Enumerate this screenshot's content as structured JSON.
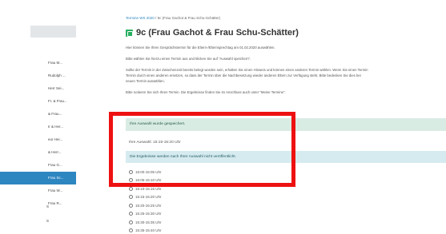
{
  "sidebar": {
    "items": [
      {
        "label": "Frau M..."
      },
      {
        "label": "Rudolph ..."
      },
      {
        "label": "Herr Sei..."
      },
      {
        "label": "Fr. & Frau..."
      },
      {
        "label": "& Frau..."
      },
      {
        "label": "Ir & Her..."
      },
      {
        "label": "eur Hei..."
      },
      {
        "label": "& Herr..."
      },
      {
        "label": "Frau G..."
      },
      {
        "label": "Frau Sc...",
        "active": true
      },
      {
        "label": "Frau W..."
      },
      {
        "label": "Frau R..."
      }
    ],
    "extra": [
      "S",
      "S"
    ]
  },
  "breadcrumb": {
    "home": "Termine WS 2020",
    "separator": "/",
    "current": "9c (Frau Gachot & Frau Schu-Schätter)"
  },
  "page": {
    "title": "9c (Frau Gachot & Frau Schu-Schätter)"
  },
  "paragraphs": [
    "Hier können Sie Ihren Gesprächstermin für die Eltern-/Elternsprechtag am 01.02.2020 auswählen.",
    "Bitte wählen Sie hierzu einen Termin aus und klicken Sie auf \"Auswahl speichern\".",
    "Sollte der Termin in der Zwischenzeit bereits belegt worden sein, erhalten Sie einen Hinweis und können einen anderen Termin wählen. Wenn Sie einen Termin",
    "Termin durch einen anderen ersetzen, so dass der Termin über die Nachbesetzung wieder anderen Eltern zur Verfügung steht. Bitte bedenken Sie dies bei",
    "neuen Termin auswählen.",
    "Bitte notieren Sie sich Ihren Termin. Die Ergebnisse finden Sie im Anschluss auch unter \"Meine Termine\"."
  ],
  "status": {
    "success": "Ihre Auswahl wurde gespeichert.",
    "choice": "Ihre Auswahl: 15:15-15:20 Uhr",
    "info": "Die Ergebnisse werden nach Ihrer Auswahl nicht veröffentlicht."
  },
  "slots": [
    {
      "label": "15:00-15:05 Uhr"
    },
    {
      "label": "15:05-15:10 Uhr"
    },
    {
      "label": "15:10-15:15 Uhr"
    },
    {
      "label": "15:15-15:20 Uhr"
    },
    {
      "label": "15:20-15:25 Uhr"
    },
    {
      "label": "15:25-15:30 Uhr"
    },
    {
      "label": "15:30-15:35 Uhr"
    },
    {
      "label": "15:35-15:40 Uhr"
    }
  ],
  "colors": {
    "accent": "#2e86c1",
    "title_icon": "#27ae60",
    "success_bg": "#d9ece4",
    "info_bg": "#d6ebef",
    "highlight": "#ee1111"
  }
}
